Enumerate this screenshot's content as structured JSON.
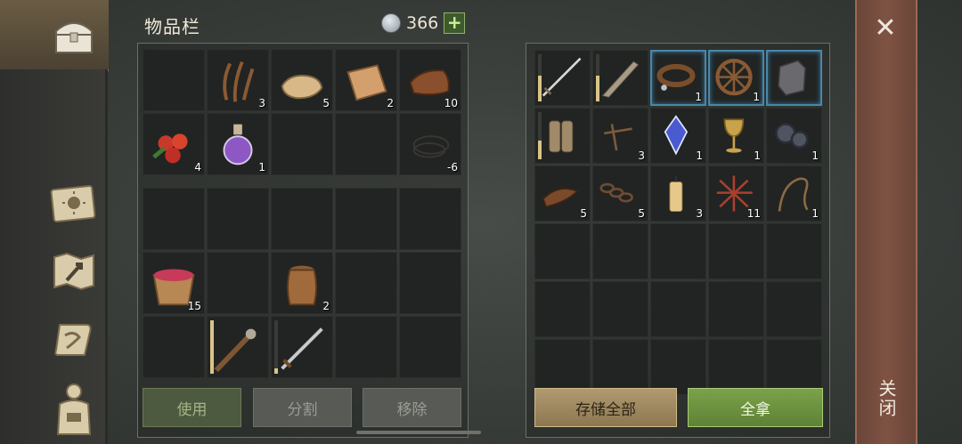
{
  "header": {
    "title": "物品栏",
    "currency_value": "366",
    "add_label": "+"
  },
  "left_panel": {
    "top_slots": [
      {
        "item": "empty",
        "count": ""
      },
      {
        "item": "plant-fiber",
        "count": "3"
      },
      {
        "item": "cloth",
        "count": "5"
      },
      {
        "item": "rope-cloth",
        "count": "2"
      },
      {
        "item": "leather",
        "count": "10"
      },
      {
        "item": "berries",
        "count": "4"
      },
      {
        "item": "potion",
        "count": "1"
      },
      {
        "item": "empty",
        "count": ""
      },
      {
        "item": "empty",
        "count": ""
      },
      {
        "item": "wire",
        "count": "-6"
      }
    ],
    "bottom_slots": [
      {
        "item": "empty",
        "count": ""
      },
      {
        "item": "empty",
        "count": ""
      },
      {
        "item": "empty",
        "count": ""
      },
      {
        "item": "empty",
        "count": ""
      },
      {
        "item": "empty",
        "count": ""
      },
      {
        "item": "berry-bucket",
        "count": "15"
      },
      {
        "item": "empty",
        "count": ""
      },
      {
        "item": "barrel",
        "count": "2"
      },
      {
        "item": "empty",
        "count": ""
      },
      {
        "item": "empty",
        "count": ""
      },
      {
        "item": "empty",
        "count": ""
      },
      {
        "item": "spiked-club",
        "count": "",
        "durability": 1.0
      },
      {
        "item": "sword",
        "count": "",
        "durability": 0.1
      },
      {
        "item": "empty",
        "count": ""
      },
      {
        "item": "empty",
        "count": ""
      }
    ]
  },
  "right_panel": {
    "slots": [
      {
        "item": "long-sword",
        "count": "",
        "durability": 0.55
      },
      {
        "item": "machete",
        "count": "",
        "durability": 0.55
      },
      {
        "item": "collar",
        "count": "1",
        "highlight": true
      },
      {
        "item": "wheel",
        "count": "1",
        "highlight": true
      },
      {
        "item": "armor-pieces",
        "count": "",
        "highlight": true
      },
      {
        "item": "gauntlets",
        "count": "",
        "durability": 0.4
      },
      {
        "item": "nails",
        "count": "3"
      },
      {
        "item": "crystal",
        "count": "1"
      },
      {
        "item": "goblet",
        "count": "1"
      },
      {
        "item": "gears",
        "count": "1"
      },
      {
        "item": "leather-strap",
        "count": "5"
      },
      {
        "item": "chain",
        "count": "5"
      },
      {
        "item": "candle",
        "count": "3"
      },
      {
        "item": "net",
        "count": "11"
      },
      {
        "item": "whip",
        "count": "1"
      },
      {
        "item": "empty",
        "count": ""
      },
      {
        "item": "empty",
        "count": ""
      },
      {
        "item": "empty",
        "count": ""
      },
      {
        "item": "empty",
        "count": ""
      },
      {
        "item": "empty",
        "count": ""
      },
      {
        "item": "empty",
        "count": ""
      },
      {
        "item": "empty",
        "count": ""
      },
      {
        "item": "empty",
        "count": ""
      },
      {
        "item": "empty",
        "count": ""
      },
      {
        "item": "empty",
        "count": ""
      },
      {
        "item": "empty",
        "count": ""
      },
      {
        "item": "empty",
        "count": ""
      },
      {
        "item": "empty",
        "count": ""
      },
      {
        "item": "empty",
        "count": ""
      },
      {
        "item": "empty",
        "count": ""
      }
    ]
  },
  "buttons": {
    "use": "使用",
    "split": "分割",
    "remove": "移除",
    "store_all": "存储全部",
    "take_all": "全拿"
  },
  "close": {
    "icon": "close-icon",
    "label": "关闭"
  },
  "sidebar": {
    "icons": [
      "chest-icon",
      "journal-sun-icon",
      "map-icon",
      "scroll-quill-icon",
      "character-icon"
    ]
  },
  "colors": {
    "accent_green": "#7ba24a",
    "highlight_blue": "#4a86a8",
    "close_panel": "#7e5343"
  }
}
